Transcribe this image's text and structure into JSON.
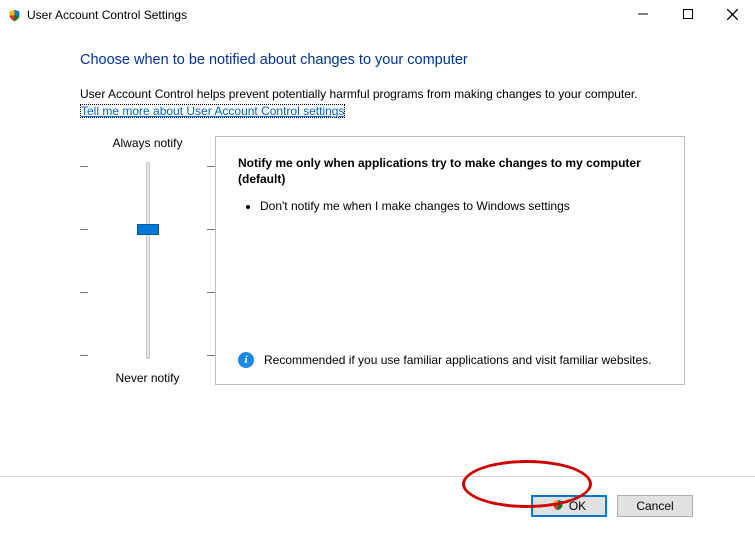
{
  "window": {
    "title": "User Account Control Settings"
  },
  "heading": "Choose when to be notified about changes to your computer",
  "description": "User Account Control helps prevent potentially harmful programs from making changes to your computer.",
  "help_link": "Tell me more about User Account Control settings",
  "slider": {
    "top_label": "Always notify",
    "bottom_label": "Never notify",
    "levels": 4,
    "selected_index": 1
  },
  "panel": {
    "title": "Notify me only when applications try to make changes to my computer (default)",
    "bullets": [
      "Don't notify me when I make changes to Windows settings"
    ],
    "recommendation": "Recommended if you use familiar applications and visit familiar websites."
  },
  "buttons": {
    "ok": "OK",
    "cancel": "Cancel"
  }
}
